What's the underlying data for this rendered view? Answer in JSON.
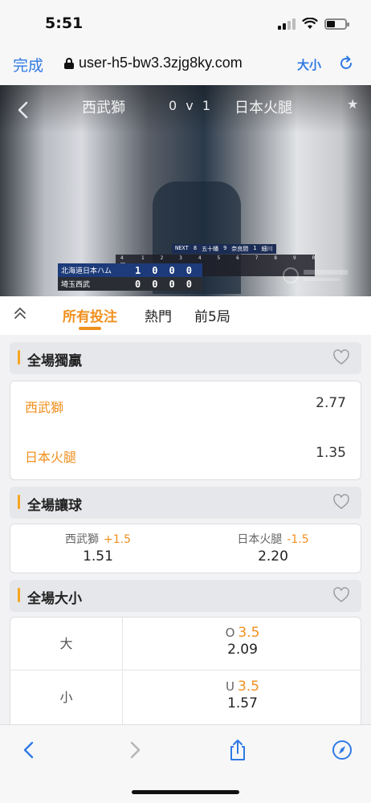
{
  "status": {
    "time": "5:51"
  },
  "browser": {
    "done_label": "完成",
    "url": "user-h5-bw3.3zjg8ky.com",
    "text_size_label": "大小"
  },
  "video": {
    "home_team": "西武獅",
    "score": "0 v 1",
    "away_team": "日本火腿",
    "scoreboard": {
      "next_label": "NEXT",
      "next_batters": [
        "8",
        "五十幡",
        "9",
        "奈良間",
        "1",
        "細川"
      ],
      "inning_label": "4回裏",
      "innings": [
        "1",
        "2",
        "3",
        "4",
        "5",
        "6",
        "7",
        "8",
        "9",
        "R"
      ],
      "rows": [
        {
          "team": "北海道日本ハム",
          "runs": [
            "1",
            "0",
            "0",
            "0"
          ]
        },
        {
          "team": "埼玉西武",
          "runs": [
            "0",
            "0",
            "0",
            "0"
          ]
        }
      ]
    }
  },
  "tabs": [
    {
      "label": "所有投注",
      "active": true
    },
    {
      "label": "熱門",
      "active": false
    },
    {
      "label": "前5局",
      "active": false
    }
  ],
  "markets": {
    "moneyline": {
      "title": "全場獨贏",
      "rows": [
        {
          "name": "西武獅",
          "odds": "2.77"
        },
        {
          "name": "日本火腿",
          "odds": "1.35"
        }
      ]
    },
    "handicap": {
      "title": "全場讓球",
      "cells": [
        {
          "name": "西武獅",
          "line": "+1.5",
          "odds": "1.51"
        },
        {
          "name": "日本火腿",
          "line": "-1.5",
          "odds": "2.20"
        }
      ]
    },
    "totals": {
      "title": "全場大小",
      "rows": [
        {
          "label": "大",
          "key": "O",
          "line": "3.5",
          "odds": "2.09"
        },
        {
          "label": "小",
          "key": "U",
          "line": "3.5",
          "odds": "1.57"
        }
      ]
    }
  },
  "colors": {
    "accent": "#f0901e",
    "link": "#2f7ae5"
  }
}
